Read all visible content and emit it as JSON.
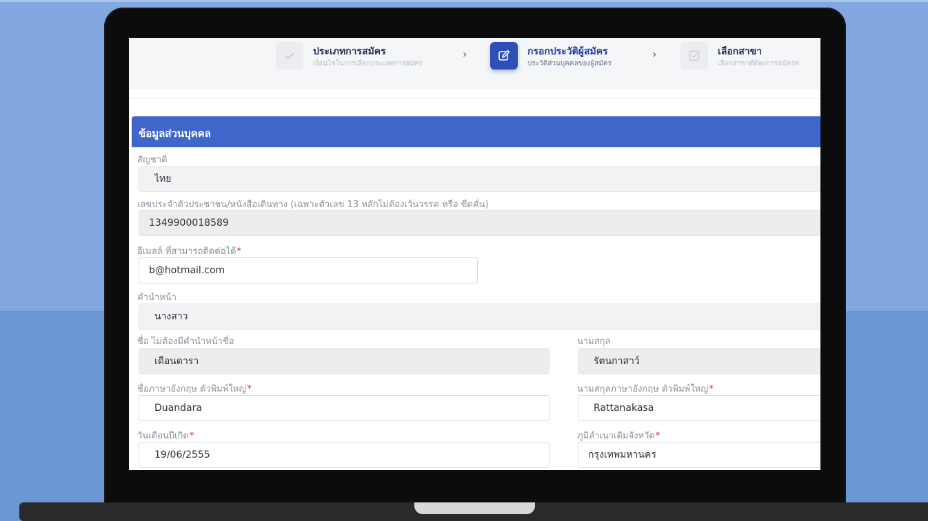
{
  "stepper": {
    "steps": [
      {
        "title": "ประเภทการสมัคร",
        "subtitle": "เงื่อนไขในการเลือกประเภทการสมัคร",
        "icon": "check-icon",
        "state": "done"
      },
      {
        "title": "กรอกประวัติผู้สมัคร",
        "subtitle": "ประวัติส่วนบุคคลของผู้สมัคร",
        "icon": "edit-icon",
        "state": "active"
      },
      {
        "title": "เลือกสาขา",
        "subtitle": "เลือกสาขาที่ต้องการสมัครต",
        "icon": "checkbox-icon",
        "state": "pending"
      }
    ],
    "separator": "›"
  },
  "section": {
    "title": "ข้อมูลส่วนบุคคล",
    "header_color": "#4066cb"
  },
  "form": {
    "nationality": {
      "label": "สัญชาติ",
      "value": "ไทย"
    },
    "id_number": {
      "label": "เลขประจำตัวประชาชน/หนังสือเดินทาง  (เฉพาะตัวเลข 13 หลักไม่ต้องเว้นวรรค หรือ ขีดคั่น)",
      "value": "1349900018589"
    },
    "email": {
      "label": "อีเมลล์ ที่สามารถติดต่อได้",
      "required_mark": "*",
      "value": "b@hotmail.com"
    },
    "title_prefix": {
      "label": "คำนำหน้า",
      "value": "นางสาว"
    },
    "first_name_th": {
      "label": "ชื่อ  ไม่ต้องมีคำนำหน้าชื่อ",
      "value": "เดือนดารา"
    },
    "last_name_th": {
      "label": "นามสกุล",
      "value": "รัตนกาสาว์"
    },
    "first_name_en": {
      "label": "ชื่อภาษาอังกฤษ  ตัวพิมพ์ใหญ่",
      "required_mark": "*",
      "value": "Duandara"
    },
    "last_name_en": {
      "label": "นามสกุลภาษาอังกฤษ  ตัวพิมพ์ใหญ่",
      "required_mark": "*",
      "value": "Rattanakasa"
    },
    "birth_date": {
      "label": "วันเดือนปีเกิด",
      "required_mark": "*",
      "value": "19/06/2555"
    },
    "birth_province": {
      "label": "ภูมิลำเนาเดิมจังหวัด",
      "required_mark": "*",
      "value": "กรุงเทพมหานคร"
    }
  }
}
